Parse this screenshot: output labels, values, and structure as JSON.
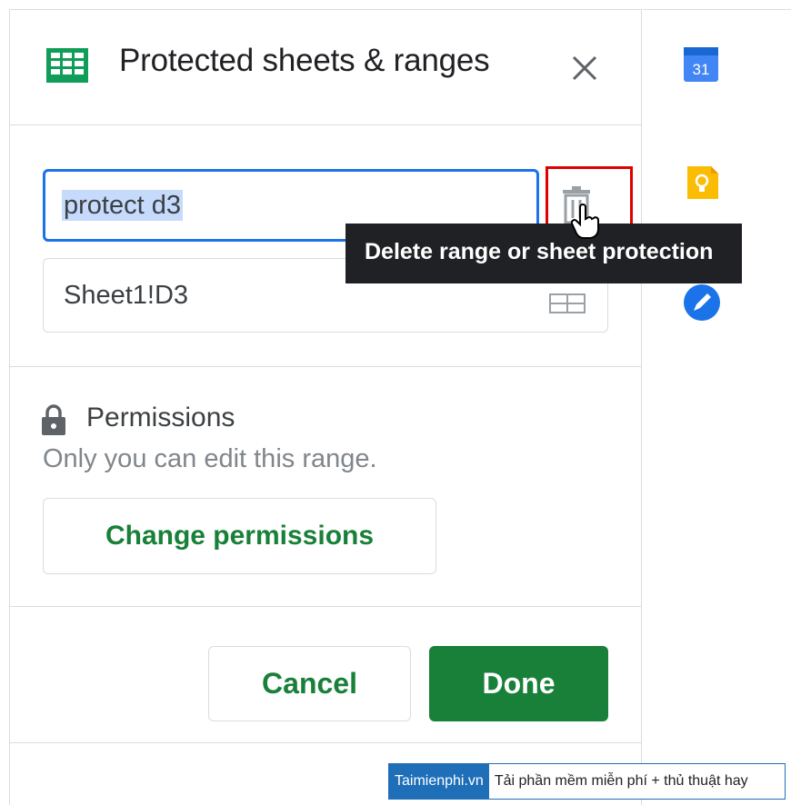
{
  "dialog": {
    "title": "Protected sheets & ranges",
    "description_value": "protect d3",
    "range_value": "Sheet1!D3",
    "tooltip": "Delete range or sheet protection",
    "permissions_title": "Permissions",
    "permissions_desc": "Only you can edit this range.",
    "change_permissions_label": "Change permissions",
    "cancel_label": "Cancel",
    "done_label": "Done"
  },
  "side_panel": {
    "calendar_day": "31"
  },
  "watermark": {
    "brand": "Taimienphi.vn",
    "tagline": "Tải phần mềm miễn phí + thủ thuật hay"
  },
  "colors": {
    "accent_green": "#188038",
    "focus_blue": "#1a73e8",
    "highlight_red": "#e00000"
  }
}
